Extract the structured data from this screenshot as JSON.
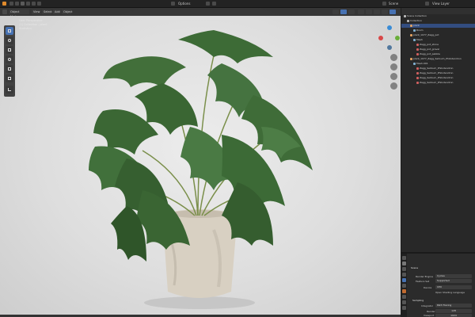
{
  "topbar": {
    "scene": "Scene",
    "view_layer": "View Layer"
  },
  "viewport": {
    "mode": "Object Mode",
    "menus": [
      "View",
      "Select",
      "Add",
      "Object"
    ],
    "options": "Options",
    "overlay_lines": [
      "User Perspective",
      "(1) Collection | plant",
      "Statistics"
    ]
  },
  "outliner": {
    "title": "Scene Collection",
    "rows": [
      {
        "label": "Collection",
        "depth": 1,
        "color": "#b7b7b7",
        "selected": false
      },
      {
        "label": "plant",
        "depth": 2,
        "color": "#e0a060",
        "selected": true
      },
      {
        "label": "Room",
        "depth": 3,
        "color": "#7fb0d0",
        "selected": false
      },
      {
        "label": "plant_1077_Zagg_pot",
        "depth": 2,
        "color": "#e0a060",
        "selected": false
      },
      {
        "label": "Mesh",
        "depth": 3,
        "color": "#7fb0d0",
        "selected": false
      },
      {
        "label": "Zagg_pot_stone",
        "depth": 4,
        "color": "#d06060",
        "selected": false
      },
      {
        "label": "Zagg_pot_gravel",
        "depth": 4,
        "color": "#d06060",
        "selected": false
      },
      {
        "label": "Zagg_pot_pebble",
        "depth": 4,
        "color": "#d06060",
        "selected": false
      },
      {
        "label": "plant_1077_Zagg_Selloum_Philodendron",
        "depth": 2,
        "color": "#e0a060",
        "selected": false
      },
      {
        "label": "Mesh.001",
        "depth": 3,
        "color": "#7fb0d0",
        "selected": false
      },
      {
        "label": "Zagg_Selloum_Philodendron",
        "depth": 4,
        "color": "#d06060",
        "selected": false
      },
      {
        "label": "Zagg_Selloum_Philodendron",
        "depth": 4,
        "color": "#d06060",
        "selected": false
      },
      {
        "label": "Zagg_Selloum_Philodendron",
        "depth": 4,
        "color": "#d06060",
        "selected": false
      },
      {
        "label": "Zagg_Selloum_Philodendron",
        "depth": 4,
        "color": "#d06060",
        "selected": false
      }
    ]
  },
  "properties": {
    "header": "Scene",
    "render_engine_label": "Render Engine",
    "render_engine": "Cycles",
    "feature_set_label": "Feature Set",
    "feature_set": "Supported",
    "device_label": "Device",
    "device": "CPU",
    "osl": "Open Shading Language",
    "sampling": "Sampling",
    "integrator_label": "Integrator",
    "integrator": "Path Tracing",
    "render_label": "Render",
    "render_samples": "128",
    "viewport_label": "Viewport",
    "viewport_samples": "1024"
  },
  "colors": {
    "accent": "#4772b3",
    "selection": "#334d80",
    "leaf": "#3f6f3a",
    "pot": "#d8d0c2"
  }
}
